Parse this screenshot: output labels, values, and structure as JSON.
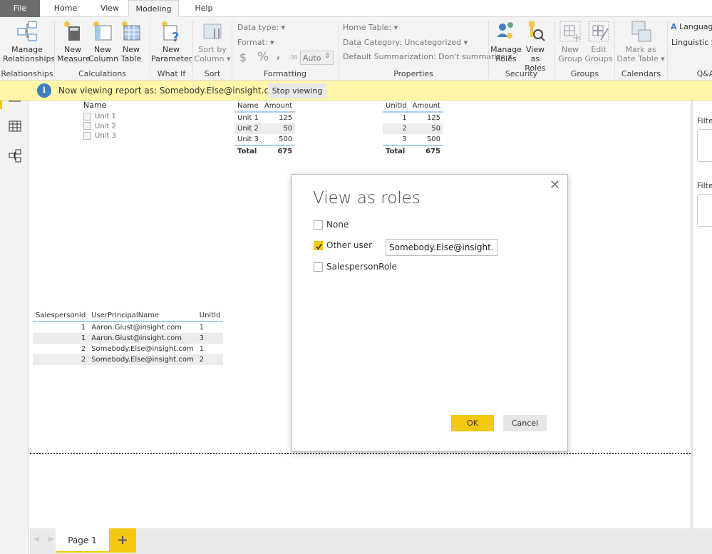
{
  "tabs": [
    {
      "label": "File"
    },
    {
      "label": "Home"
    },
    {
      "label": "View"
    },
    {
      "label": "Modeling",
      "active": true
    },
    {
      "label": "Help"
    }
  ],
  "ribbon": {
    "groups": [
      {
        "label": "Relationships",
        "buttons": [
          {
            "label": "Manage Relationships",
            "icon": "relationships-icon"
          }
        ]
      },
      {
        "label": "Calculations",
        "buttons": [
          {
            "label": "New Measure",
            "icon": "calculator-icon"
          },
          {
            "label": "New Column",
            "icon": "column-icon"
          },
          {
            "label": "New Table",
            "icon": "table-icon"
          }
        ]
      },
      {
        "label": "What If",
        "buttons": [
          {
            "label": "New Parameter",
            "icon": "parameter-icon"
          }
        ]
      },
      {
        "label": "Sort",
        "buttons": [
          {
            "label": "Sort by Column",
            "icon": "sort-icon",
            "disabled": true
          }
        ]
      },
      {
        "label": "Formatting",
        "data_type": "Data type:",
        "format": "Format:",
        "currency": "$",
        "percent": "%",
        "comma": ",",
        "decimals": ".00",
        "auto": "Auto"
      },
      {
        "label": "Properties",
        "home_table": "Home Table:",
        "data_category": "Data Category: Uncategorized",
        "default_summarization": "Default Summarization: Don't summarize"
      },
      {
        "label": "Security",
        "buttons": [
          {
            "label": "Manage Roles",
            "icon": "manage-roles-icon"
          },
          {
            "label": "View as Roles",
            "icon": "view-as-roles-icon"
          }
        ]
      },
      {
        "label": "Groups",
        "buttons": [
          {
            "label": "New Group",
            "icon": "new-group-icon",
            "disabled": true
          },
          {
            "label": "Edit Groups",
            "icon": "edit-groups-icon",
            "disabled": true
          }
        ]
      },
      {
        "label": "Calendars",
        "buttons": [
          {
            "label": "Mark as Date Table",
            "icon": "date-table-icon",
            "disabled": true
          }
        ]
      },
      {
        "label": "Q&A",
        "language": "Languag",
        "linguistic": "Linguistic Sc"
      }
    ]
  },
  "banner": {
    "text": "Now viewing report as: Somebody.Else@insight.com",
    "stop": "Stop viewing"
  },
  "slicer": {
    "title": "Name",
    "items": [
      "Unit 1",
      "Unit 2",
      "Unit 3"
    ]
  },
  "table1": {
    "headers": [
      "Name",
      "Amount"
    ],
    "rows": [
      [
        "Unit 1",
        "125"
      ],
      [
        "Unit 2",
        "50"
      ],
      [
        "Unit 3",
        "500"
      ]
    ],
    "total": [
      "Total",
      "675"
    ]
  },
  "table2": {
    "headers": [
      "UnitId",
      "Amount"
    ],
    "rows": [
      [
        "1",
        "125"
      ],
      [
        "2",
        "50"
      ],
      [
        "3",
        "500"
      ]
    ],
    "total": [
      "Total",
      "675"
    ]
  },
  "table3": {
    "headers": [
      "SalespersonId",
      "UserPrincipalName",
      "UnitId"
    ],
    "rows": [
      [
        "1",
        "Aaron.Giust@insight.com",
        "1"
      ],
      [
        "1",
        "Aaron.Giust@insight.com",
        "3"
      ],
      [
        "2",
        "Somebody.Else@insight.com",
        "1"
      ],
      [
        "2",
        "Somebody.Else@insight.com",
        "2"
      ]
    ]
  },
  "right_pane": {
    "filter1": "Filte",
    "filter2": "Filte"
  },
  "dialog": {
    "title": "View as roles",
    "options": [
      {
        "label": "None",
        "checked": false
      },
      {
        "label": "Other user",
        "checked": true
      },
      {
        "label": "SalespersonRole",
        "checked": false
      }
    ],
    "other_user_value": "Somebody.Else@insight.com",
    "ok": "OK",
    "cancel": "Cancel"
  },
  "pages": {
    "tabs": [
      "Page 1"
    ],
    "add": "+"
  },
  "colors": {
    "accent": "#f2c811",
    "banner": "#fff6a8",
    "info": "#3f7fbf"
  }
}
